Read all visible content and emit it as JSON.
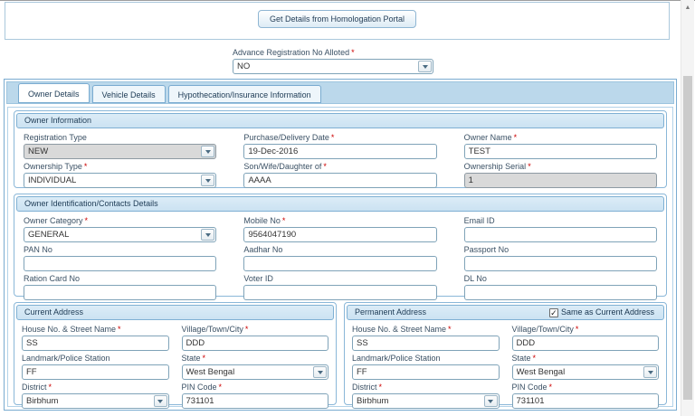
{
  "colors": {
    "accent_blue": "#79abd0",
    "tab_strip_bg": "#bbd8eb",
    "section_header_bg": "#d3e7f5",
    "disabled_field_bg": "#d9d9d9",
    "required_red": "#cc0000",
    "label_text": "#3a5064"
  },
  "icons": {
    "dropdown_arrow": "dropdown-arrow",
    "check": "✓",
    "scroll_up": "▲"
  },
  "misc": {
    "required_marker": "*"
  },
  "top": {
    "homologation_button": "Get Details from Homologation Portal"
  },
  "advance_registration": {
    "label": "Advance Registration No Alloted",
    "value": "NO"
  },
  "tabs": {
    "active": "Owner Details",
    "items": [
      {
        "label": "Owner Details"
      },
      {
        "label": "Vehicle Details"
      },
      {
        "label": "Hypothecation/Insurance Information"
      }
    ]
  },
  "owner_information": {
    "title": "Owner Information",
    "registration_type_label": "Registration Type",
    "registration_type_value": "NEW",
    "purchase_date_label": "Purchase/Delivery Date",
    "purchase_date_value": "19-Dec-2016",
    "owner_name_label": "Owner Name",
    "owner_name_value": "TEST",
    "ownership_type_label": "Ownership Type",
    "ownership_type_value": "INDIVIDUAL",
    "swd_label": "Son/Wife/Daughter of",
    "swd_value": "AAAA",
    "ownership_serial_label": "Ownership Serial",
    "ownership_serial_value": "1"
  },
  "owner_identification": {
    "title": "Owner Identification/Contacts Details",
    "owner_category_label": "Owner Category",
    "owner_category_value": "GENERAL",
    "mobile_label": "Mobile No",
    "mobile_value": "9564047190",
    "email_label": "Email ID",
    "pan_label": "PAN No",
    "aadhar_label": "Aadhar No",
    "passport_label": "Passport No",
    "ration_label": "Ration Card No",
    "voter_label": "Voter ID",
    "dl_label": "DL No"
  },
  "current_address": {
    "title": "Current Address",
    "house_label": "House No. & Street Name",
    "house_value": "SS",
    "village_label": "Village/Town/City",
    "village_value": "DDD",
    "landmark_label": "Landmark/Police Station",
    "landmark_value": "FF",
    "state_label": "State",
    "state_value": "West Bengal",
    "district_label": "District",
    "district_value": "Birbhum",
    "pin_label": "PIN Code",
    "pin_value": "731101"
  },
  "permanent_address": {
    "title": "Permanent Address",
    "same_as_current_label": "Same as Current Address",
    "same_as_current_checked": true,
    "house_label": "House No. & Street Name",
    "house_value": "SS",
    "village_label": "Village/Town/City",
    "village_value": "DDD",
    "landmark_label": "Landmark/Police Station",
    "landmark_value": "FF",
    "state_label": "State",
    "state_value": "West Bengal",
    "district_label": "District",
    "district_value": "Birbhum",
    "pin_label": "PIN Code",
    "pin_value": "731101"
  }
}
